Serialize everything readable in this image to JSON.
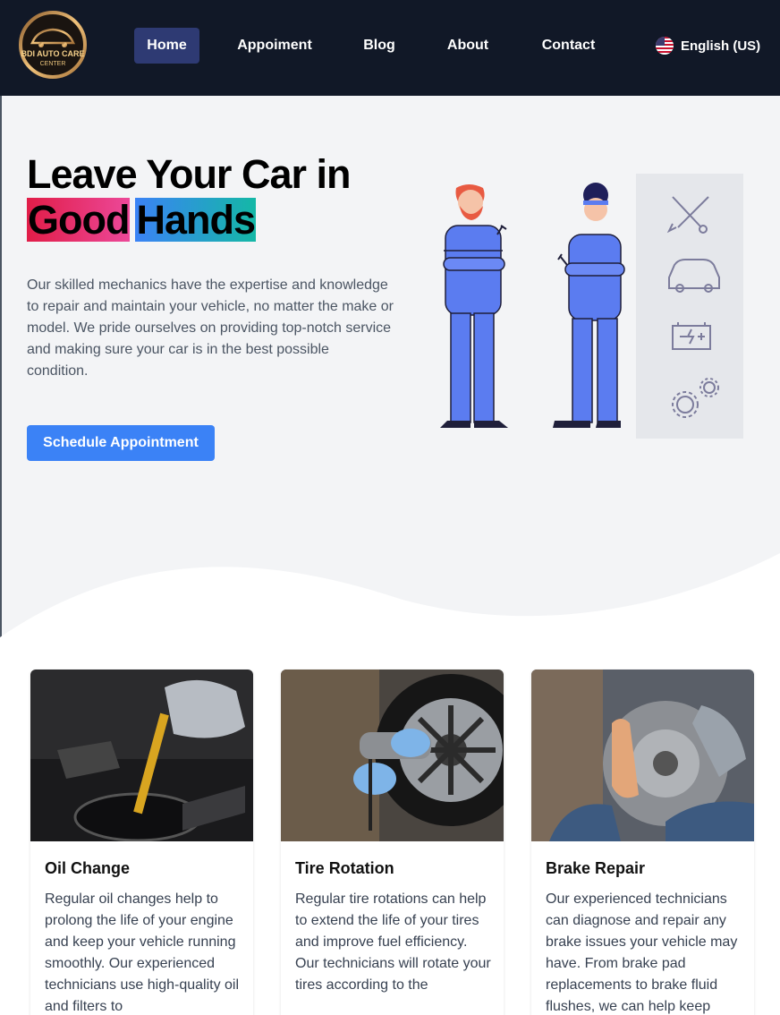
{
  "brand": {
    "logo_line1": "BDI AUTO CARE",
    "logo_line2": "CENTER",
    "accent": "#c89b5a"
  },
  "nav": {
    "items": [
      {
        "label": "Home",
        "active": true
      },
      {
        "label": "Appoiment",
        "active": false
      },
      {
        "label": "Blog",
        "active": false
      },
      {
        "label": "About",
        "active": false
      },
      {
        "label": "Contact",
        "active": false
      }
    ],
    "language": "English (US)"
  },
  "hero": {
    "title_line1": "Leave Your Car in",
    "highlight1": "Good",
    "highlight2": "Hands",
    "body": "Our skilled mechanics have the expertise and knowledge to repair and maintain your vehicle, no matter the make or model. We pride ourselves on providing top-notch service and making sure your car is in the best possible condition.",
    "cta": "Schedule Appointment"
  },
  "services": [
    {
      "title": "Oil Change",
      "text": "Regular oil changes help to prolong the life of your engine and keep your vehicle running smoothly. Our experienced technicians use high-quality oil and filters to"
    },
    {
      "title": "Tire Rotation",
      "text": "Regular tire rotations can help to extend the life of your tires and improve fuel efficiency. Our technicians will rotate your tires according to the"
    },
    {
      "title": "Brake Repair",
      "text": "Our experienced technicians can diagnose and repair any brake issues your vehicle may have. From brake pad replacements to brake fluid flushes, we can help keep"
    }
  ],
  "colors": {
    "nav_bg": "#111827",
    "active_nav": "#2e3a73",
    "cta": "#3b82f6",
    "page_bg": "#f3f4f6"
  }
}
